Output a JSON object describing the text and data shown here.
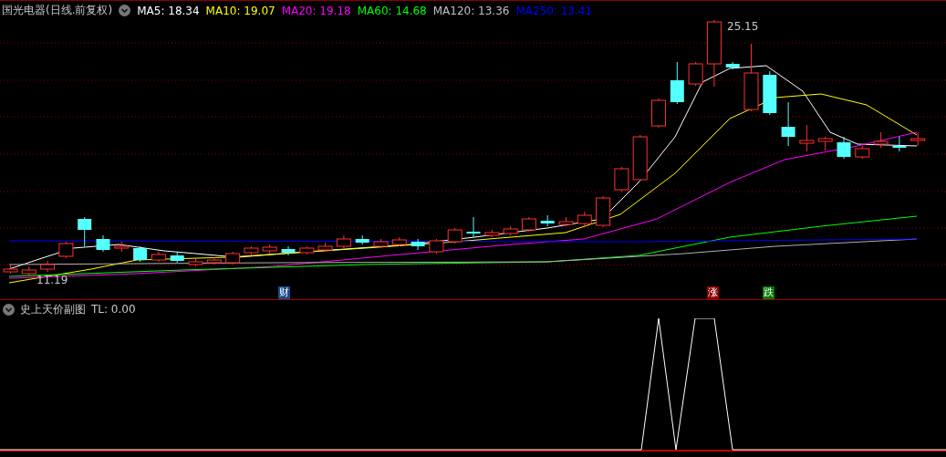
{
  "chart_title": "国光电器(日线.前复权)",
  "indicators": [
    {
      "text": "MA5: 18.34",
      "color": "#ffffff"
    },
    {
      "text": "MA10: 19.07",
      "color": "#ffff00"
    },
    {
      "text": "MA20: 19.18",
      "color": "#ff00ff"
    },
    {
      "text": "MA60: 14.68",
      "color": "#00ff00"
    },
    {
      "text": "MA120: 13.36",
      "color": "#c0c0c0"
    },
    {
      "text": "MA250: 13.41",
      "color": "#0000ff"
    }
  ],
  "price_labels": {
    "high": "25.15",
    "low": "11.19"
  },
  "markers": [
    {
      "text": "财",
      "color": "#1a4a8a"
    },
    {
      "text": "涨",
      "color": "#8a0000"
    },
    {
      "text": "跌",
      "color": "#007a00"
    }
  ],
  "sub_panel": {
    "title": "史上天价副图",
    "reading": "TL: 0.00"
  }
}
